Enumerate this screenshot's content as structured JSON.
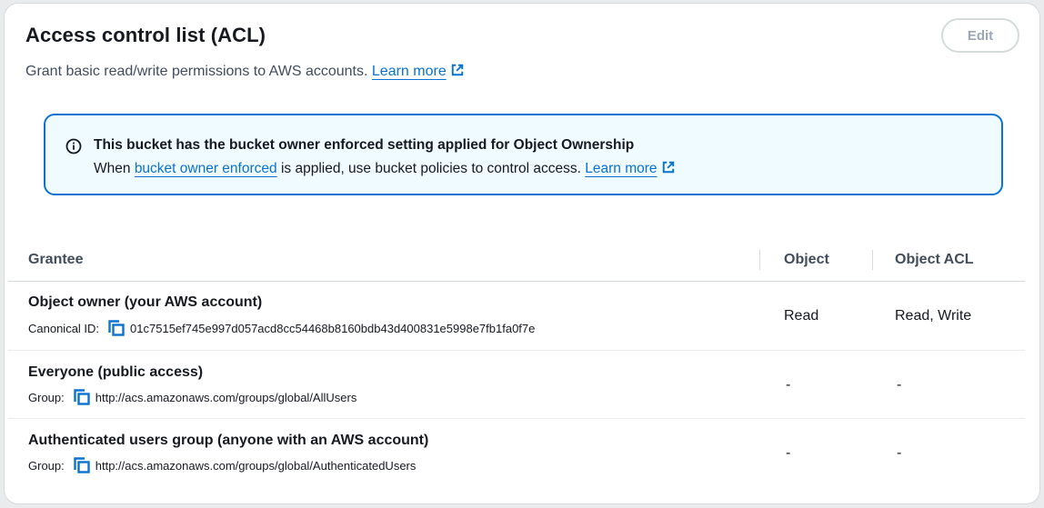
{
  "panel": {
    "title": "Access control list (ACL)",
    "description": "Grant basic read/write permissions to AWS accounts.",
    "learn_more": "Learn more",
    "edit_label": "Edit"
  },
  "alert": {
    "title": "This bucket has the bucket owner enforced setting applied for Object Ownership",
    "body_prefix": "When",
    "body_link": "bucket owner enforced",
    "body_suffix": "is applied, use bucket policies to control access.",
    "learn_more": "Learn more"
  },
  "table": {
    "headers": {
      "grantee": "Grantee",
      "object": "Object",
      "object_acl": "Object ACL"
    },
    "rows": [
      {
        "grantee": "Object owner (your AWS account)",
        "id_label": "Canonical ID:",
        "id_value": "01c7515ef745e997d057acd8cc54468b8160bdb43d400831e5998e7fb1fa0f7e",
        "object": "Read",
        "object_acl": "Read, Write"
      },
      {
        "grantee": "Everyone (public access)",
        "id_label": "Group:",
        "id_value": "http://acs.amazonaws.com/groups/global/AllUsers",
        "object": "-",
        "object_acl": "-"
      },
      {
        "grantee": "Authenticated users group (anyone with an AWS account)",
        "id_label": "Group:",
        "id_value": "http://acs.amazonaws.com/groups/global/AuthenticatedUsers",
        "object": "-",
        "object_acl": "-"
      }
    ]
  },
  "colors": {
    "link": "#0972d3",
    "alert_border": "#0972d3",
    "alert_bg": "#f0fbff",
    "text": "#16191f",
    "muted": "#414d5c"
  },
  "icons": {
    "external_link": "external-link-icon",
    "info": "info-icon",
    "copy": "copy-icon"
  }
}
